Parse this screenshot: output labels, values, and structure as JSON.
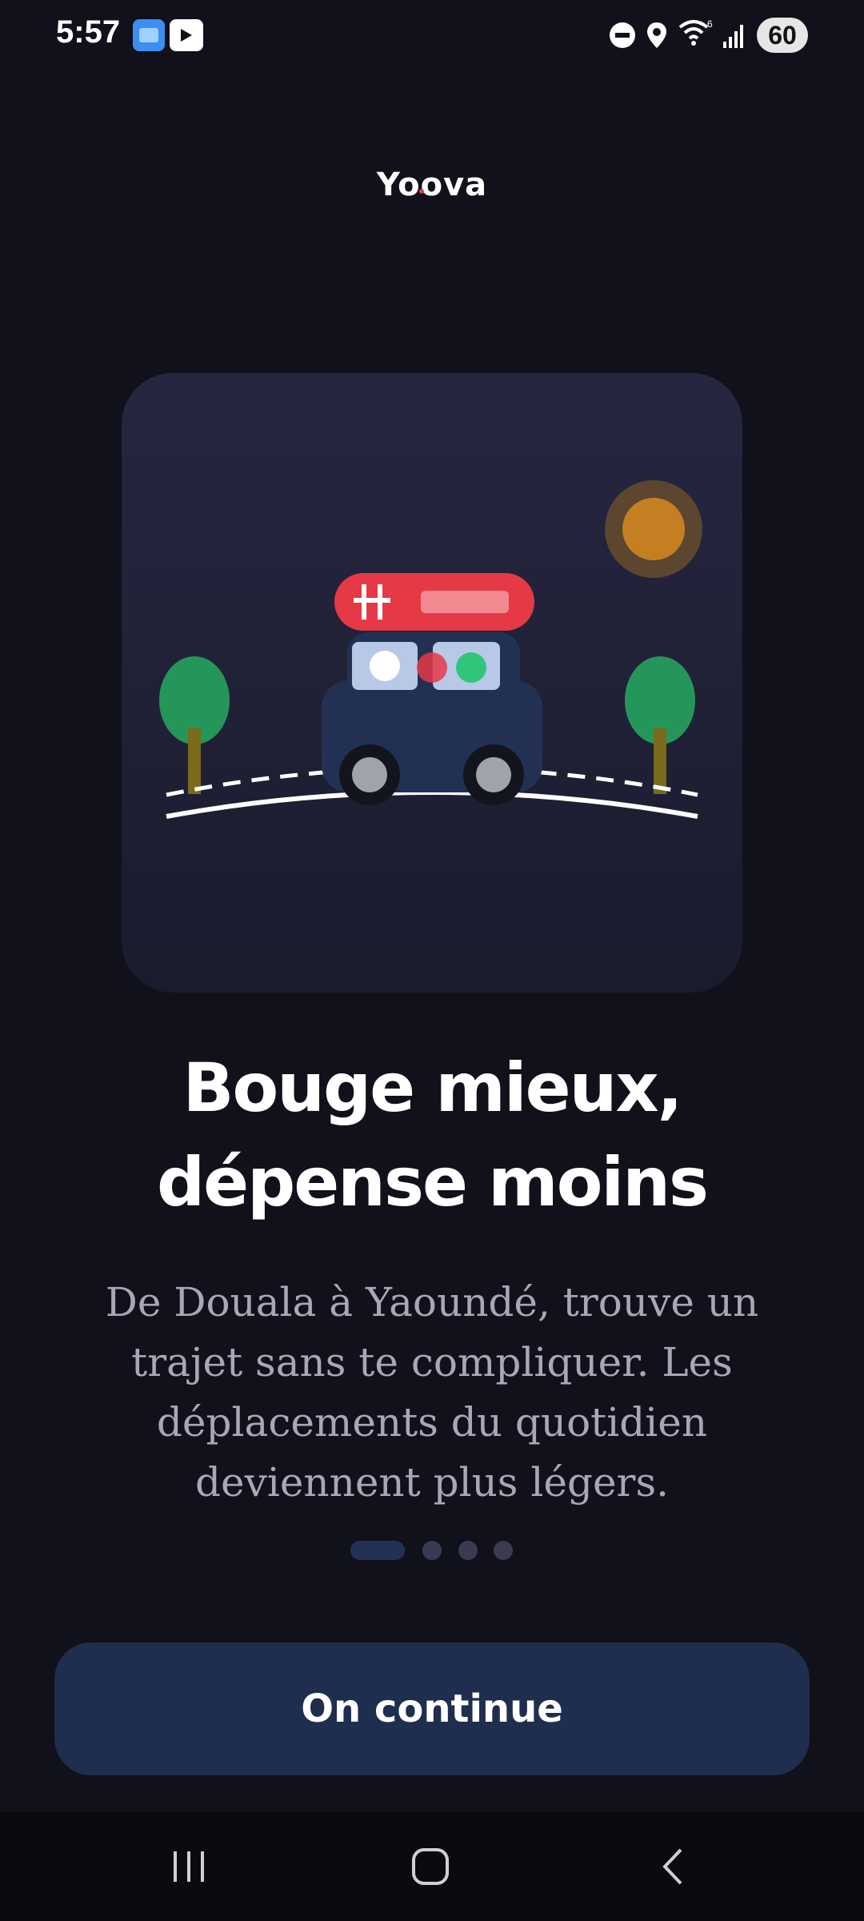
{
  "status_bar": {
    "time": "5:57",
    "battery": "60",
    "icons": [
      "gallery-app-icon",
      "youtube-icon",
      "dnd-icon",
      "location-icon",
      "wifi-icon",
      "signal-icon"
    ],
    "wifi_label": "6"
  },
  "brand": {
    "name": "Yoova",
    "accent": "#e63946"
  },
  "illustration": {
    "description_icons": [
      "bus-icon",
      "sun-icon",
      "tree-icon",
      "road-icon"
    ],
    "colors": {
      "card": "#262640",
      "bus": "#223153",
      "roof": "#e63946",
      "sun": "#c47f22",
      "tree": "#24965a",
      "trunk": "#7a6a1c",
      "road": "#ffffff"
    }
  },
  "headline": {
    "line1": "Bouge mieux,",
    "line2": "dépense moins"
  },
  "subtext": "De Douala à Yaoundé, trouve un trajet sans te compliquer. Les déplacements du quotidien deviennent plus légers.",
  "pager": {
    "current": 1,
    "total": 4
  },
  "cta": {
    "label": "On continue",
    "color": "#1f2d4e"
  },
  "navbar": {
    "buttons": [
      "recents-icon",
      "home-icon",
      "back-icon"
    ]
  }
}
